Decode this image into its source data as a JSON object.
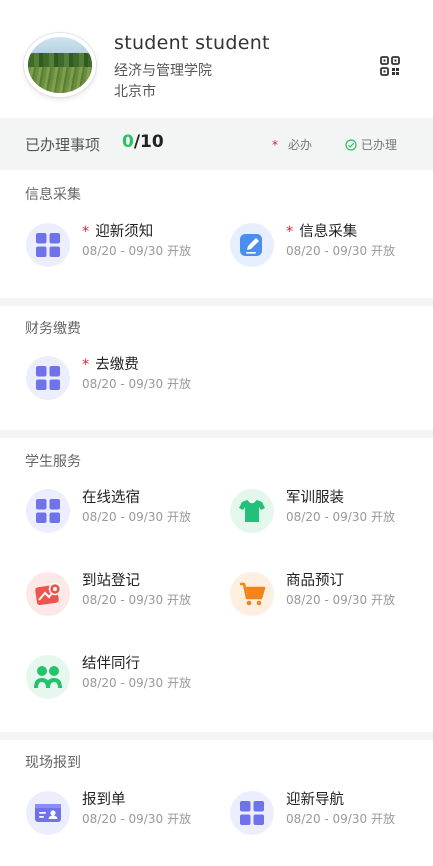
{
  "profile": {
    "name": "student student",
    "college": "经济与管理学院",
    "city": "北京市"
  },
  "progress": {
    "label": "已办理事项",
    "done": "0",
    "total": "/10",
    "legend_required": "必办",
    "legend_done": "已办理"
  },
  "sections": [
    {
      "title": "信息采集",
      "items": [
        {
          "label": "迎新须知",
          "required": true,
          "date": "08/20 - 09/30 开放",
          "icon": "grid-icon"
        },
        {
          "label": "信息采集",
          "required": true,
          "date": "08/20 - 09/30 开放",
          "icon": "edit-icon"
        }
      ]
    },
    {
      "title": "财务缴费",
      "items": [
        {
          "label": "去缴费",
          "required": true,
          "date": "08/20 - 09/30 开放",
          "icon": "grid-icon"
        }
      ]
    },
    {
      "title": "学生服务",
      "items": [
        {
          "label": "在线选宿",
          "required": false,
          "date": "08/20 - 09/30 开放",
          "icon": "grid-icon"
        },
        {
          "label": "军训服装",
          "required": false,
          "date": "08/20 - 09/30 开放",
          "icon": "tshirt-icon"
        },
        {
          "label": "到站登记",
          "required": false,
          "date": "08/20 - 09/30 开放",
          "icon": "map-pin-icon"
        },
        {
          "label": "商品预订",
          "required": false,
          "date": "08/20 - 09/30 开放",
          "icon": "cart-icon"
        },
        {
          "label": "结伴同行",
          "required": false,
          "date": "08/20 - 09/30 开放",
          "icon": "people-icon"
        }
      ]
    },
    {
      "title": "现场报到",
      "items": [
        {
          "label": "报到单",
          "required": false,
          "date": "08/20 - 09/30 开放",
          "icon": "id-card-icon"
        },
        {
          "label": "迎新导航",
          "required": false,
          "date": "08/20 - 09/30 开放",
          "icon": "grid-icon"
        }
      ]
    }
  ],
  "colors": {
    "accent_done": "#2dbf6a",
    "required_star": "#e0222a",
    "icon_purple": "#6f73ea"
  }
}
